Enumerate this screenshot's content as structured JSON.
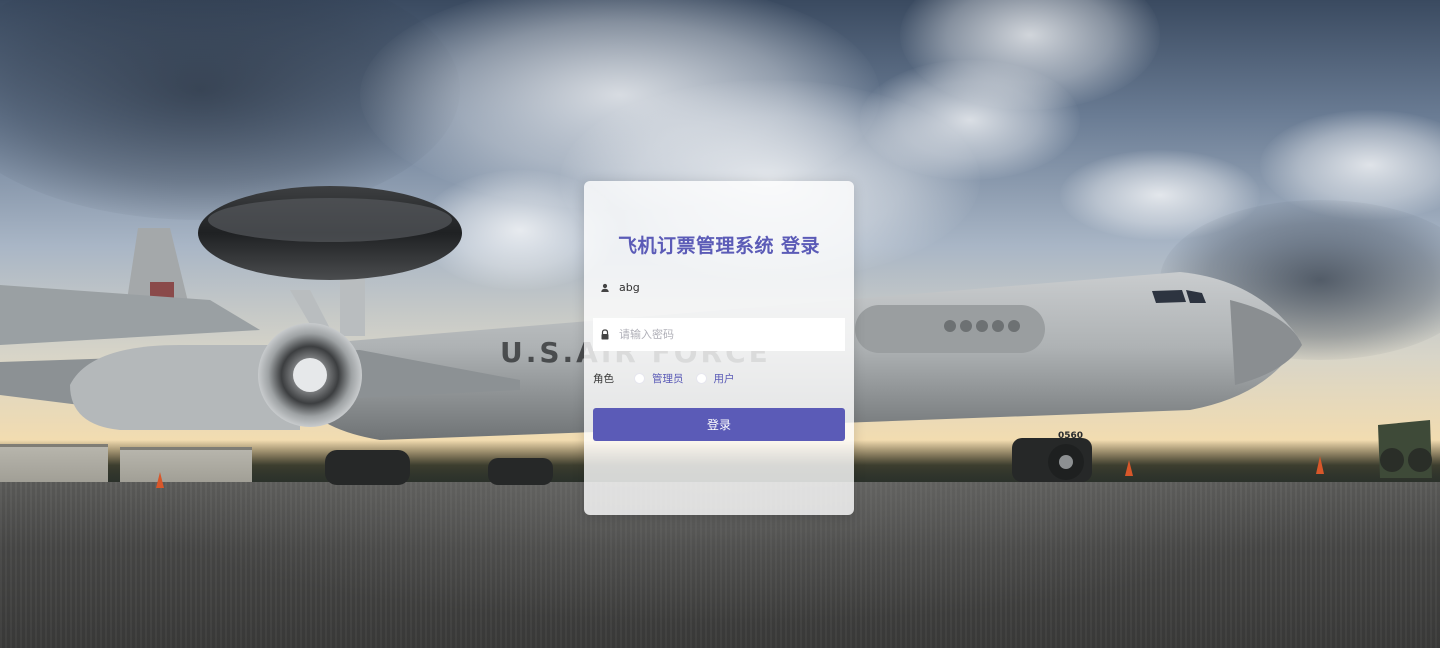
{
  "login": {
    "title": "飞机订票管理系统 登录",
    "username_value": "abg",
    "password_placeholder": "请输入密码",
    "role_label": "角色",
    "role_options": [
      "管理员",
      "用户"
    ],
    "submit_label": "登录"
  },
  "background": {
    "fuselage_text": "U.S.AIR FORCE",
    "tail_number": "0560"
  },
  "colors": {
    "accent": "#5b5bb7",
    "card_background": "rgba(255,255,255,0.80)"
  },
  "icons": {
    "username": "user-icon",
    "password": "lock-icon"
  }
}
